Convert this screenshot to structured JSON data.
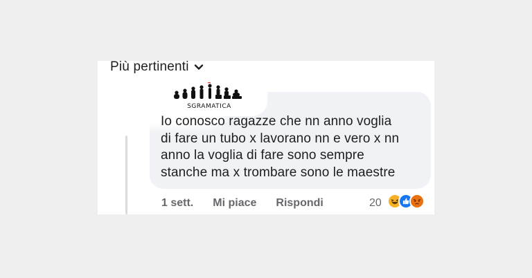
{
  "header": {
    "sort_label": "Più pertinenti",
    "sort_icon": "chevron-down-icon"
  },
  "comment": {
    "author_logo_text": "SGRAMATICA",
    "text_lines": [
      "Io conosco ragazze che nn anno voglia",
      "di fare un tubo x lavorano nn e vero x nn",
      "anno la voglia di fare sono sempre",
      "stanche ma x trombare sono le maestre"
    ],
    "time": "1 sett.",
    "like_label": "Mi piace",
    "reply_label": "Rispondi",
    "reaction_count": "20",
    "reactions": [
      "haha-icon",
      "like-icon",
      "angry-icon"
    ]
  },
  "colors": {
    "bubble": "#f0f2f5",
    "meta_text": "#65676b",
    "like_blue": "#1877f2",
    "haha_yellow": "#f7b125",
    "angry_orange": "#e9710f"
  }
}
